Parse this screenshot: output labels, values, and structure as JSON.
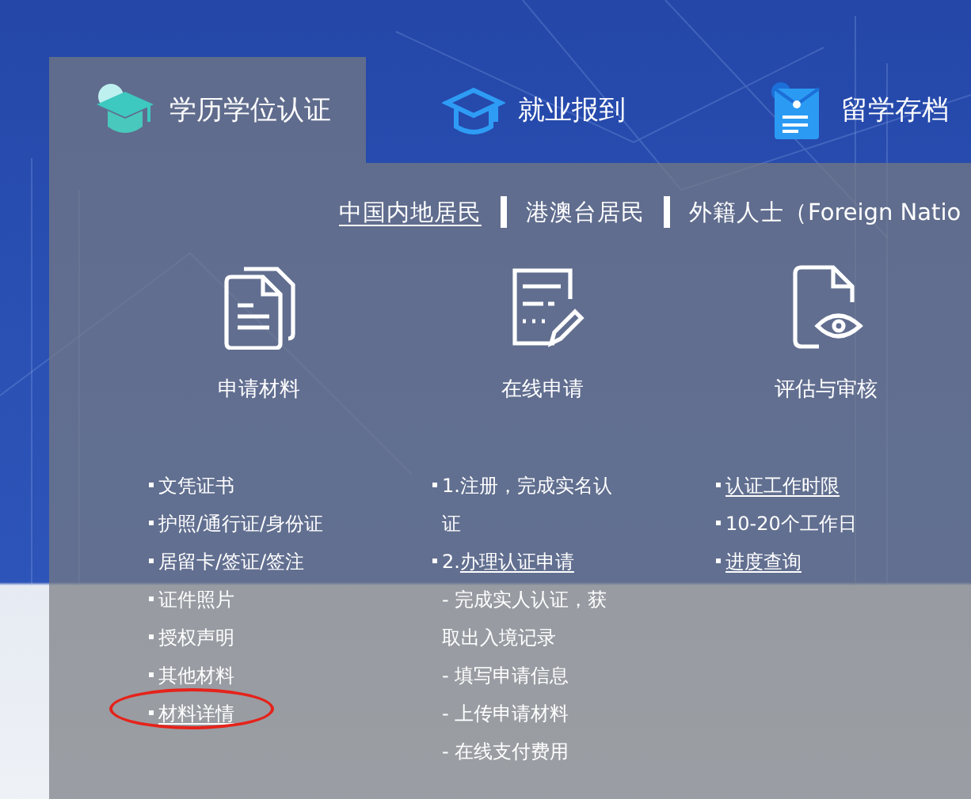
{
  "tabs": [
    {
      "label": "学历学位认证",
      "kind": "cap",
      "selected": true
    },
    {
      "label": "就业报到",
      "kind": "cap-outline",
      "selected": false
    },
    {
      "label": "留学存档",
      "kind": "folder",
      "selected": false
    }
  ],
  "audience_tabs": [
    {
      "label": "中国内地居民",
      "selected": true
    },
    {
      "label": "港澳台居民",
      "selected": false
    },
    {
      "label": "外籍人士（Foreign Natio",
      "selected": false
    }
  ],
  "columns": [
    {
      "title": "申请材料",
      "kind": "documents",
      "items": [
        {
          "kind": "bullet",
          "text": "文凭证书",
          "circled": false
        },
        {
          "kind": "bullet",
          "text": "护照/通行证/身份证",
          "circled": false
        },
        {
          "kind": "bullet",
          "text": "居留卡/签证/签注",
          "circled": false
        },
        {
          "kind": "bullet",
          "text": "证件照片",
          "circled": false
        },
        {
          "kind": "bullet",
          "text": "授权声明",
          "circled": false
        },
        {
          "kind": "bullet",
          "text": "其他材料",
          "circled": false
        },
        {
          "kind": "link",
          "text": "材料详情",
          "circled": true
        }
      ]
    },
    {
      "title": "在线申请",
      "kind": "form",
      "items": [
        {
          "kind": "bullet",
          "text": "1.注册，完成实名认证",
          "circled": false
        },
        {
          "kind": "mixed",
          "prefix": "2.",
          "text": "办理认证申请",
          "circled": false
        },
        {
          "kind": "sub",
          "text": "- 完成实人认证，获取出入境记录",
          "circled": false
        },
        {
          "kind": "sub",
          "text": "- 填写申请信息",
          "circled": false
        },
        {
          "kind": "sub",
          "text": "- 上传申请材料",
          "circled": false
        },
        {
          "kind": "sub",
          "text": "- 在线支付费用",
          "circled": false
        }
      ]
    },
    {
      "title": "评估与审核",
      "kind": "review",
      "items": [
        {
          "kind": "link",
          "text": "认证工作时限",
          "circled": false
        },
        {
          "kind": "bullet",
          "text": "10-20个工作日",
          "circled": false
        },
        {
          "kind": "link",
          "text": "进度查询",
          "circled": false
        }
      ]
    }
  ]
}
